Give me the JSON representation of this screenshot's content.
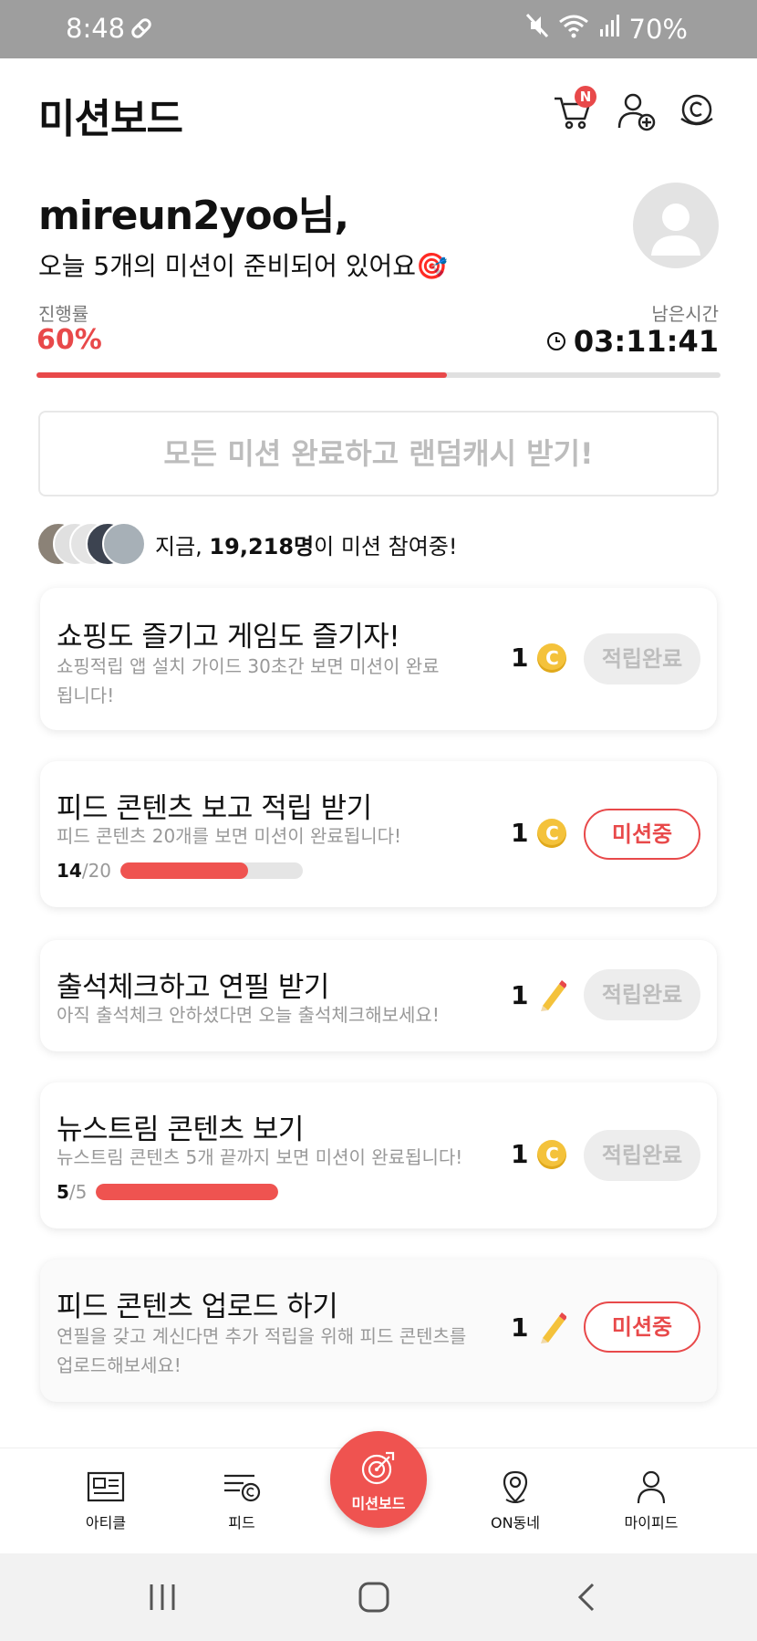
{
  "status_bar": {
    "time": "8:48",
    "battery": "70%"
  },
  "header": {
    "title": "미션보드",
    "cart_badge": "N"
  },
  "greeting": {
    "name": "mireun2yoo님,",
    "subtitle": "오늘 5개의 미션이 준비되어 있어요🎯"
  },
  "progress": {
    "label": "진행률",
    "value_text": "60%",
    "value": 0.6
  },
  "timer": {
    "label": "남은시간",
    "value": "03:11:41"
  },
  "reward_button": {
    "label": "모든 미션 완료하고 랜덤캐시 받기!"
  },
  "participants": {
    "prefix": "지금, ",
    "count": "19,218명",
    "suffix": "이 미션 참여중!"
  },
  "missions": [
    {
      "title": "쇼핑도 즐기고 게임도 즐기자!",
      "desc": "쇼핑적립 앱 설치 가이드 30초간 보면 미션이 완료됩니다!",
      "reward": "1",
      "reward_icon": "coin-icon",
      "status": "적립완료",
      "coin_symbol": "C"
    },
    {
      "title": "피드 콘텐츠 보고 적립 받기",
      "desc": "피드 콘텐츠 20개를 보면 미션이 완료됩니다!",
      "reward": "1",
      "reward_icon": "coin-icon",
      "status": "미션중",
      "progress_current": "14",
      "progress_total": "/20",
      "progress_value": 0.7,
      "coin_symbol": "C"
    },
    {
      "title": "출석체크하고 연필 받기",
      "desc": "아직 출석체크 안하셨다면 오늘 출석체크해보세요!",
      "reward": "1",
      "reward_icon": "pencil-icon",
      "status": "적립완료"
    },
    {
      "title": "뉴스트림 콘텐츠 보기",
      "desc": "뉴스트림 콘텐츠 5개 끝까지 보면 미션이 완료됩니다!",
      "reward": "1",
      "reward_icon": "coin-icon",
      "status": "적립완료",
      "progress_current": "5",
      "progress_total": "/5",
      "progress_value": 1.0,
      "coin_symbol": "C"
    },
    {
      "title": "피드 콘텐츠 업로드 하기",
      "desc": "연필을 갖고 계신다면 추가 적립을 위해 피드 콘텐츠를 업로드해보세요!",
      "reward": "1",
      "reward_icon": "pencil-icon",
      "status": "미션중"
    }
  ],
  "bottom_nav": {
    "items": [
      {
        "label": "아티클",
        "icon": "article-icon"
      },
      {
        "label": "피드",
        "icon": "feed-icon"
      },
      {
        "label": "미션보드",
        "icon": "target-icon"
      },
      {
        "label": "ON동네",
        "icon": "location-icon"
      },
      {
        "label": "마이피드",
        "icon": "person-icon"
      }
    ]
  },
  "colors": {
    "accent": "#e8494a",
    "coin": "#f4c23b",
    "status_bar": "#9e9e9e"
  }
}
